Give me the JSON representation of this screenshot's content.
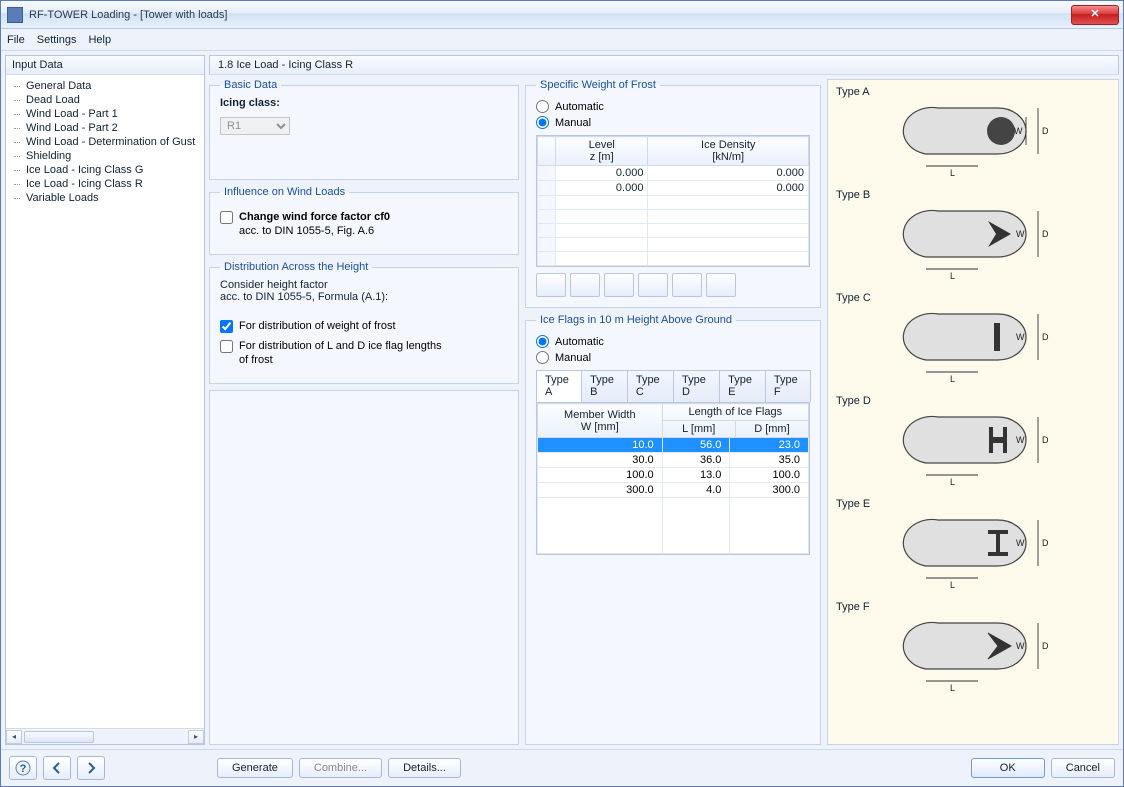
{
  "window": {
    "title": "RF-TOWER Loading - [Tower with loads]"
  },
  "menu": {
    "file": "File",
    "settings": "Settings",
    "help": "Help"
  },
  "sidebar": {
    "header": "Input Data",
    "items": [
      "General Data",
      "Dead Load",
      "Wind Load - Part 1",
      "Wind Load - Part 2",
      "Wind Load - Determination of Gust",
      "Shielding",
      "Ice Load - Icing Class G",
      "Ice Load - Icing Class R",
      "Variable Loads"
    ]
  },
  "page": {
    "title": "1.8 Ice Load - Icing Class R"
  },
  "basic": {
    "legend": "Basic Data",
    "icing_class_label": "Icing class:",
    "icing_class_value": "R1"
  },
  "influence": {
    "legend": "Influence on Wind Loads",
    "chk_label": "Change wind force factor cf0",
    "chk_sub": "acc. to DIN 1055-5, Fig. A.6"
  },
  "distribution": {
    "legend": "Distribution Across the Height",
    "intro1": "Consider height factor",
    "intro2": "acc. to DIN 1055-5, Formula (A.1):",
    "chk1": "For distribution of weight of frost",
    "chk2_line1": "For distribution of L and D ice flag lengths",
    "chk2_line2": "of frost"
  },
  "specific": {
    "legend": "Specific Weight of Frost",
    "auto": "Automatic",
    "manual": "Manual",
    "hdr_level": "Level",
    "hdr_level_unit": "z [m]",
    "hdr_density": "Ice Density",
    "hdr_density_unit": "[kN/m]",
    "rows": [
      {
        "z": "0.000",
        "d": "0.000"
      },
      {
        "z": "0.000",
        "d": "0.000"
      }
    ]
  },
  "iceflags": {
    "legend": "Ice Flags in 10 m Height Above Ground",
    "auto": "Automatic",
    "manual": "Manual",
    "tabs": [
      "Type A",
      "Type B",
      "Type C",
      "Type D",
      "Type E",
      "Type F"
    ],
    "active_tab": 0,
    "hdr_w": "Member Width",
    "hdr_w_unit": "W [mm]",
    "hdr_len": "Length of Ice Flags",
    "hdr_l_unit": "L [mm]",
    "hdr_d_unit": "D [mm]",
    "data": [
      {
        "w": "10.0",
        "l": "56.0",
        "d": "23.0"
      },
      {
        "w": "30.0",
        "l": "36.0",
        "d": "35.0"
      },
      {
        "w": "100.0",
        "l": "13.0",
        "d": "100.0"
      },
      {
        "w": "300.0",
        "l": "4.0",
        "d": "300.0"
      }
    ]
  },
  "diagrams": {
    "labels": [
      "Type A",
      "Type B",
      "Type C",
      "Type D",
      "Type E",
      "Type F"
    ]
  },
  "footer": {
    "generate": "Generate",
    "combine": "Combine...",
    "details": "Details...",
    "ok": "OK",
    "cancel": "Cancel"
  }
}
